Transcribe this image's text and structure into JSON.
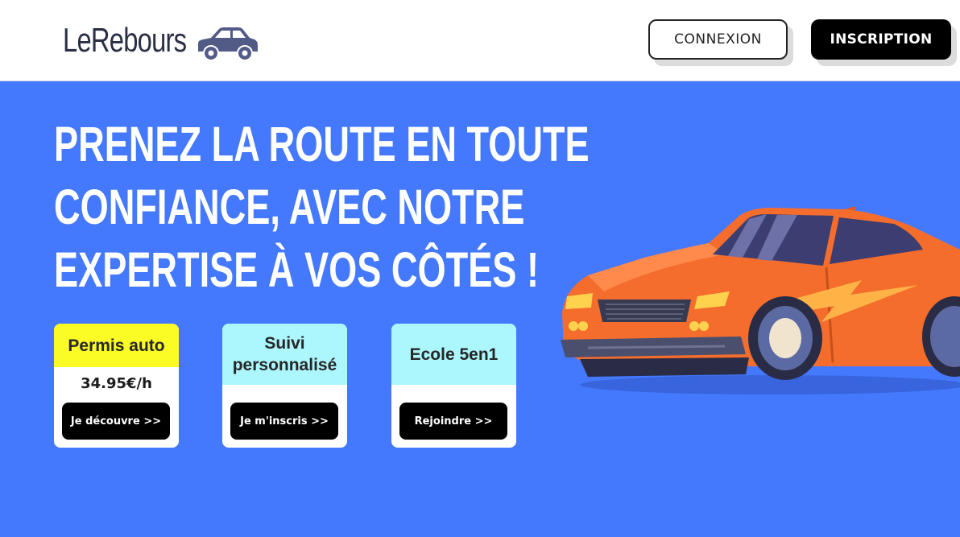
{
  "header": {
    "logo_text": "LeRebours",
    "login_label": "CONNEXION",
    "signup_label": "INSCRIPTION"
  },
  "hero": {
    "title_lines": [
      "PRENEZ LA ROUTE EN TOUTE",
      "CONFIANCE, AVEC NOTRE",
      "EXPERTISE À VOS CÔTÉS !"
    ]
  },
  "cards": [
    {
      "title": "Permis auto",
      "price": "34.95€/h",
      "button": "Je découvre >>",
      "color": "#fbfb26"
    },
    {
      "title": "Suivi personnalisé",
      "button": "Je m'inscris >>",
      "color": "#acf7fd"
    },
    {
      "title": "Ecole 5en1",
      "button": "Rejoindre >>",
      "color": "#acf7fd"
    }
  ],
  "colors": {
    "background": "#4479fe",
    "header": "#ffffff",
    "car_body": "#f46d2d"
  },
  "icons": {
    "logo": "car-icon",
    "hero": "sports-car-illustration"
  }
}
